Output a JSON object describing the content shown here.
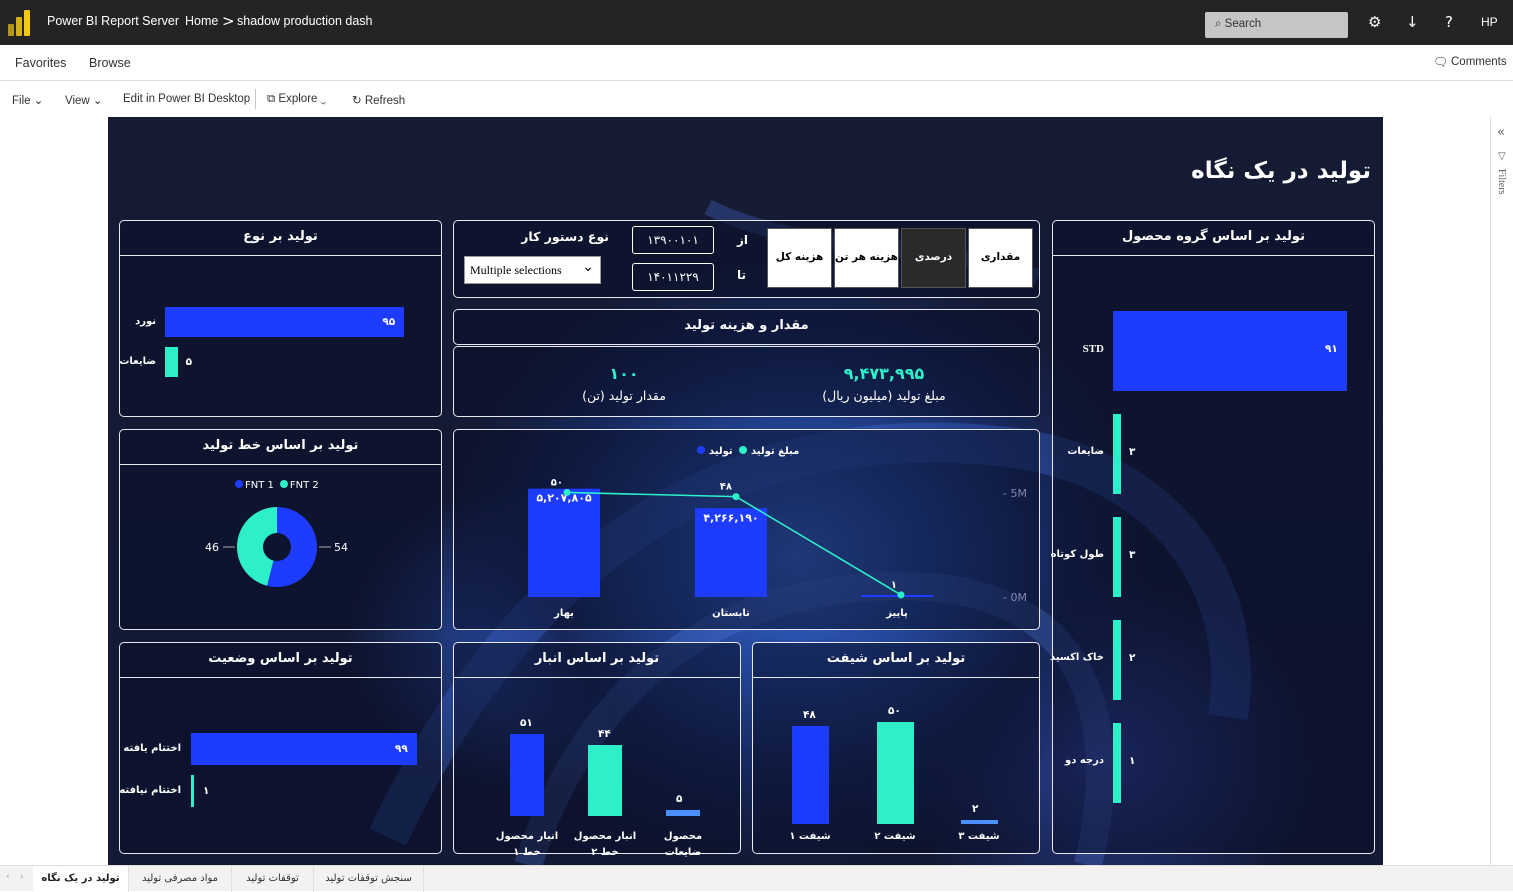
{
  "app": {
    "title": "Power BI Report Server",
    "breadcrumb_home": "Home",
    "breadcrumb_sep": ">",
    "page_name": "shadow production dash",
    "search_placeholder": "Search",
    "user": "HP"
  },
  "nav": {
    "favorites": "Favorites",
    "browse": "Browse",
    "comments": "Comments"
  },
  "toolbar": {
    "file": "File",
    "view": "View",
    "edit": "Edit in Power BI Desktop",
    "explore": "Explore",
    "refresh": "Refresh"
  },
  "filters_label": "Filters",
  "report": {
    "title": "تولید در یک نگاه",
    "type_panel": {
      "title": "تولید بر نوع",
      "items": [
        {
          "label": "نورد",
          "value": "۹۵",
          "pct": 95,
          "color": "#1e3cff"
        },
        {
          "label": "ضایعات",
          "value": "۵",
          "pct": 5,
          "color": "#2ef0c8"
        }
      ]
    },
    "work_order": {
      "title": "نوع دستور کار",
      "select": "Multiple selections"
    },
    "dates": {
      "from_label": "از",
      "to_label": "تا",
      "from": "۱۳۹۰۰۱۰۱",
      "to": "۱۴۰۱۱۲۲۹"
    },
    "segments": [
      {
        "label": "مقداری",
        "active": false
      },
      {
        "label": "درصدی",
        "active": true
      },
      {
        "label": "هزینه هر تن",
        "active": false
      },
      {
        "label": "هزینه کل",
        "active": false
      }
    ],
    "group_panel": {
      "title": "تولید بر اساس گروه محصول",
      "items": [
        {
          "label": "STD",
          "value": "۹۱",
          "pct": 91
        },
        {
          "label": "ضایعات",
          "value": "۳",
          "pct": 3
        },
        {
          "label": "طول کوتاه",
          "value": "۳",
          "pct": 3
        },
        {
          "label": "خاک اکسید",
          "value": "۲",
          "pct": 2
        },
        {
          "label": "درجه دو",
          "value": "۱",
          "pct": 1
        }
      ]
    },
    "amount_panel": {
      "title": "مقدار و هزینه تولید",
      "qty_value": "۱۰۰",
      "qty_label": "مقدار تولید (تن)",
      "amt_value": "۹,۴۷۳,۹۹۵",
      "amt_label": "مبلغ تولید (میلیون ریال)"
    },
    "line_panel": {
      "title": "تولید بر اساس خط تولید",
      "legend": [
        "FNT 1",
        "FNT 2"
      ],
      "colors": [
        "#1e3cff",
        "#2ef0c8"
      ]
    },
    "status_panel": {
      "title": "تولید بر اساس وضعیت",
      "items": [
        {
          "label": "اختتام یافته",
          "value": "۹۹",
          "pct": 99,
          "color": "#1e3cff"
        },
        {
          "label": "اختتام نیافته",
          "value": "۱",
          "pct": 1,
          "color": "#2ef0c8"
        }
      ]
    },
    "warehouse_panel": {
      "title": "تولید بر اساس انبار",
      "items": [
        {
          "label1": "انبار محصول",
          "label2": "خط ۱",
          "value": "۵۱",
          "num": 51,
          "color": "#1e3cff"
        },
        {
          "label1": "انبار محصول",
          "label2": "خط ۲",
          "value": "۴۴",
          "num": 44,
          "color": "#2ef0c8"
        },
        {
          "label1": "محصول",
          "label2": "ضایعات",
          "value": "۵",
          "num": 5,
          "color": "#4a90ff"
        }
      ]
    },
    "shift_panel": {
      "title": "تولید بر اساس شیفت",
      "items": [
        {
          "label": "شیفت ۱",
          "value": "۴۸",
          "num": 48,
          "color": "#1e3cff"
        },
        {
          "label": "شیفت ۲",
          "value": "۵۰",
          "num": 50,
          "color": "#2ef0c8"
        },
        {
          "label": "شیفت ۳",
          "value": "۲",
          "num": 2,
          "color": "#4a90ff"
        }
      ]
    }
  },
  "chart_data": [
    {
      "type": "pie",
      "title": "تولید بر اساس خط تولید",
      "categories": [
        "FNT 1",
        "FNT 2"
      ],
      "values": [
        54,
        46
      ],
      "colors": [
        "#1e3cff",
        "#2ef0c8"
      ]
    },
    {
      "type": "bar",
      "title": "",
      "categories": [
        "بهار",
        "تابستان",
        "پاییز"
      ],
      "series": [
        {
          "name": "مبلغ تولید",
          "kind": "bar",
          "values": [
            5207805,
            4266190,
            0
          ],
          "labels": [
            "۵,۲۰۷,۸۰۵",
            "۴,۲۶۶,۱۹۰",
            ""
          ],
          "color": "#1e3cff"
        },
        {
          "name": "تولید",
          "kind": "line",
          "values": [
            50,
            48,
            1
          ],
          "labels": [
            "۵۰",
            "۴۸",
            "۱"
          ],
          "color": "#2ef0c8"
        }
      ],
      "y_ticks": [
        "5M",
        "0M"
      ],
      "ylim": [
        0,
        5800000
      ],
      "legend": "top"
    }
  ],
  "sheet_tabs": [
    "تولید در یک نگاه",
    "مواد مصرفی تولید",
    "توقفات تولید",
    "سنجش توقفات تولید"
  ]
}
